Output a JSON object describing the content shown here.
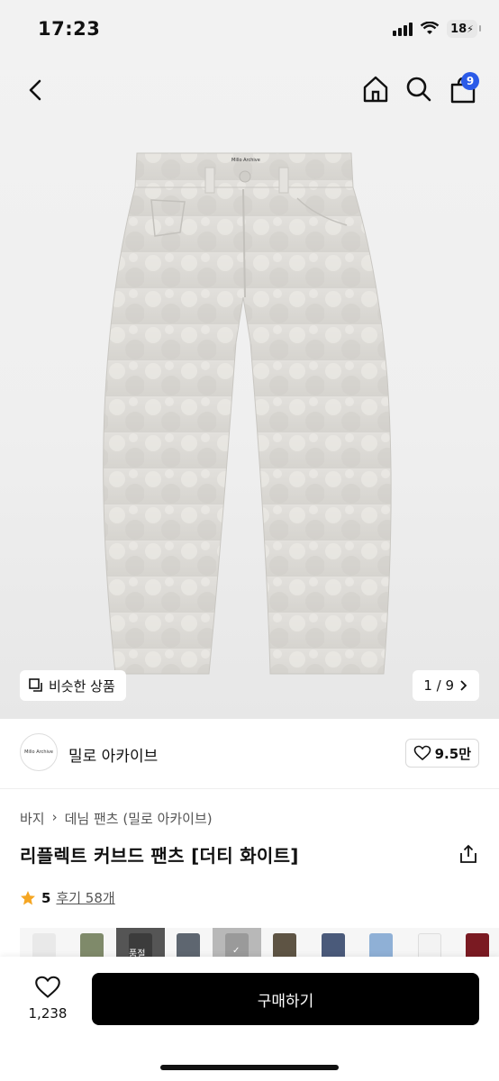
{
  "status": {
    "time": "17:23",
    "battery": "18"
  },
  "nav": {
    "cart_count": "9"
  },
  "gallery": {
    "similar_label": "비슷한 상품",
    "pager": "1 / 9"
  },
  "brand": {
    "logo_text": "Millo Archive",
    "name": "밀로 아카이브",
    "likes": "9.5만"
  },
  "product": {
    "breadcrumb": [
      "바지",
      "데님 팬츠 (밀로 아카이브)"
    ],
    "title": "리플렉트 커브드 팬츠 [더티 화이트]",
    "rating": "5",
    "reviews": "후기 58개",
    "waist_label": "Millo Archive"
  },
  "thumbs": [
    {
      "color": "#e9e9e9",
      "label": ""
    },
    {
      "color": "#7f8a6a",
      "label": ""
    },
    {
      "color": "#3c3c3c",
      "label": "품절"
    },
    {
      "color": "#5e6670",
      "label": ""
    },
    {
      "color": "#9a9a9a",
      "label": "✓"
    },
    {
      "color": "#5e5444",
      "label": ""
    },
    {
      "color": "#4a5a7a",
      "label": ""
    },
    {
      "color": "#8fb0d6",
      "label": ""
    },
    {
      "color": "#f3f3f3",
      "label": ""
    },
    {
      "color": "#7a1a22",
      "label": ""
    }
  ],
  "footer": {
    "wish_count": "1,238",
    "buy_label": "구매하기"
  },
  "colors": {
    "accent": "#2b5be8",
    "buy_bg": "#000000",
    "star": "#f5a623"
  }
}
